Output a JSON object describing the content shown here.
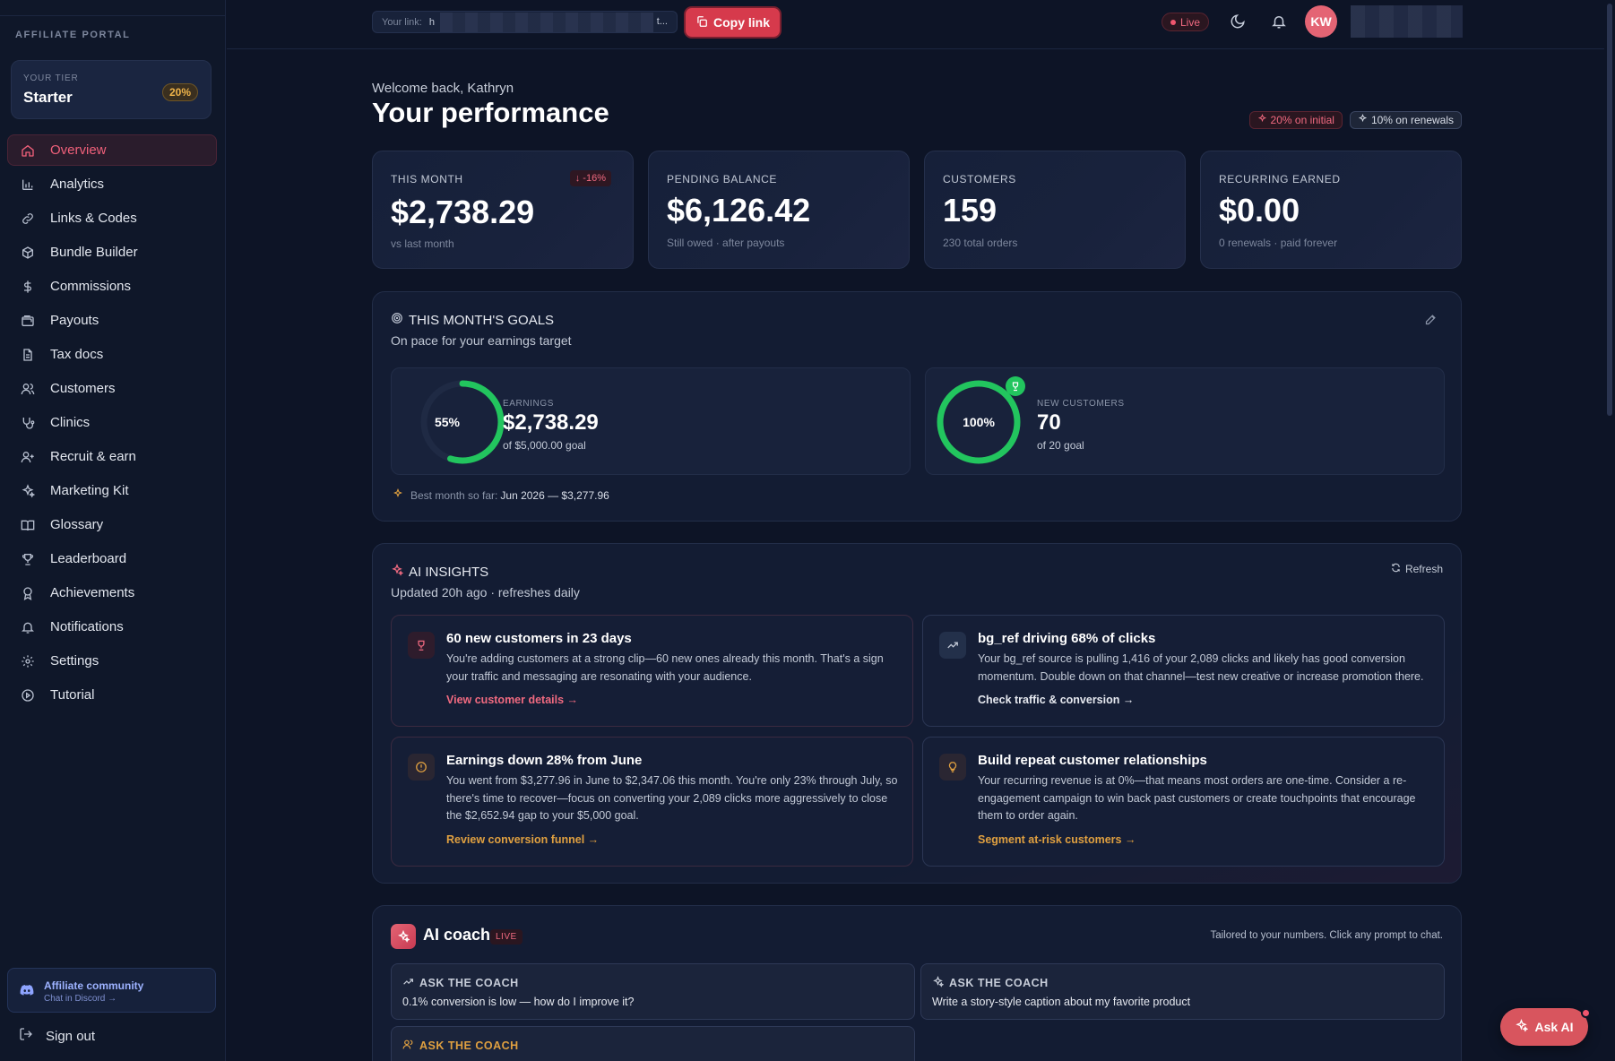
{
  "sidebar": {
    "portal_label": "AFFILIATE PORTAL",
    "tier": {
      "label": "YOUR TIER",
      "name": "Starter",
      "percent": "20%"
    },
    "items": [
      {
        "label": "Overview",
        "icon": "home-icon",
        "active": true
      },
      {
        "label": "Analytics",
        "icon": "bar-chart-icon"
      },
      {
        "label": "Links & Codes",
        "icon": "link-icon"
      },
      {
        "label": "Bundle Builder",
        "icon": "package-icon"
      },
      {
        "label": "Commissions",
        "icon": "dollar-icon"
      },
      {
        "label": "Payouts",
        "icon": "wallet-icon"
      },
      {
        "label": "Tax docs",
        "icon": "document-icon"
      },
      {
        "label": "Customers",
        "icon": "users-icon"
      },
      {
        "label": "Clinics",
        "icon": "stethoscope-icon"
      },
      {
        "label": "Recruit & earn",
        "icon": "user-plus-icon"
      },
      {
        "label": "Marketing Kit",
        "icon": "sparkles-icon"
      },
      {
        "label": "Glossary",
        "icon": "book-icon"
      },
      {
        "label": "Leaderboard",
        "icon": "trophy-icon"
      },
      {
        "label": "Achievements",
        "icon": "award-icon"
      },
      {
        "label": "Notifications",
        "icon": "bell-icon"
      },
      {
        "label": "Settings",
        "icon": "gear-icon"
      },
      {
        "label": "Tutorial",
        "icon": "play-circle-icon"
      }
    ],
    "community": {
      "title": "Affiliate community",
      "subtitle": "Chat in Discord →"
    },
    "signout": "Sign out"
  },
  "topbar": {
    "link_label": "Your link:",
    "link_start": "h",
    "link_end": "t...",
    "copy_label": "Copy link",
    "live_label": "Live",
    "avatar_initials": "KW"
  },
  "header": {
    "welcome": "Welcome back, Kathryn",
    "title": "Your performance",
    "rate_initial": "20% on initial",
    "rate_renewals": "10% on renewals"
  },
  "stats": [
    {
      "label": "THIS MONTH",
      "value": "$2,738.29",
      "sub": "vs last month",
      "delta": "↓ -16%"
    },
    {
      "label": "PENDING BALANCE",
      "value": "$6,126.42",
      "sub": "Still owed · after payouts"
    },
    {
      "label": "CUSTOMERS",
      "value": "159",
      "sub": "230 total orders"
    },
    {
      "label": "RECURRING EARNED",
      "value": "$0.00",
      "sub": "0 renewals · paid forever"
    }
  ],
  "goals": {
    "title": "THIS MONTH'S GOALS",
    "subtitle": "On pace for your earnings target",
    "earnings": {
      "percent_label": "55%",
      "progress": 0.55,
      "label": "EARNINGS",
      "value": "$2,738.29",
      "goal": "of $5,000.00 goal"
    },
    "customers": {
      "percent_label": "100%",
      "progress": 1.0,
      "label": "NEW CUSTOMERS",
      "value": "70",
      "goal": "of 20 goal"
    },
    "best_month_label": "Best month so far:",
    "best_month_value": "Jun 2026 — $3,277.96"
  },
  "insights": {
    "title": "AI INSIGHTS",
    "subtitle": "Updated 20h ago · refreshes daily",
    "refresh": "Refresh",
    "cards": [
      {
        "title": "60 new customers in 23 days",
        "body": "You're adding customers at a strong clip—60 new ones already this month. That's a sign your traffic and messaging are resonating with your audience.",
        "link": "View customer details →",
        "icon": "trophy-icon"
      },
      {
        "title": "bg_ref driving 68% of clicks",
        "body": "Your bg_ref source is pulling 1,416 of your 2,089 clicks and likely has good conversion momentum. Double down on that channel—test new creative or increase promotion there.",
        "link": "Check traffic & conversion →",
        "icon": "trending-up-icon"
      },
      {
        "title": "Earnings down 28% from June",
        "body": "You went from $3,277.96 in June to $2,347.06 this month. You're only 23% through July, so there's time to recover—focus on converting your 2,089 clicks more aggressively to close the $2,652.94 gap to your $5,000 goal.",
        "link": "Review conversion funnel →",
        "icon": "alert-circle-icon"
      },
      {
        "title": "Build repeat customer relationships",
        "body": "Your recurring revenue is at 0%—that means most orders are one-time. Consider a re-engagement campaign to win back past customers or create touchpoints that encourage them to order again.",
        "link": "Segment at-risk customers →",
        "icon": "lightbulb-icon"
      }
    ]
  },
  "coach": {
    "title": "AI coach",
    "badge": "LIVE",
    "note": "Tailored to your numbers. Click any prompt to chat.",
    "prompts": [
      {
        "heading": "ASK THE COACH",
        "text": "0.1% conversion is low — how do I improve it?",
        "icon": "trending-up-icon"
      },
      {
        "heading": "ASK THE COACH",
        "text": "Write a story-style caption about my favorite product",
        "icon": "sparkles-icon"
      },
      {
        "heading": "ASK THE COACH",
        "text": "",
        "icon": "users-icon"
      }
    ]
  },
  "ask_ai": "Ask AI",
  "colors": {
    "accent": "#e46474",
    "success": "#22c55e",
    "warning": "#e0a040",
    "background": "#0d1426"
  }
}
